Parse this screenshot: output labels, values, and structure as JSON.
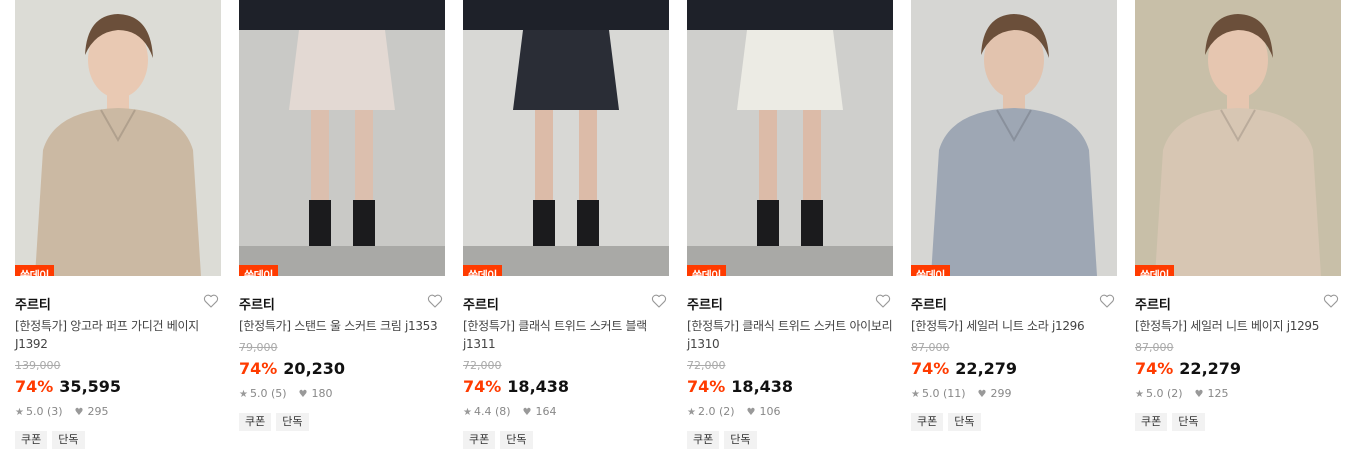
{
  "products": [
    {
      "badge": "쑥데이",
      "brand": "주르티",
      "name": "[한정특가] 앙고라 퍼프 가디건 베이지 J1392",
      "original_price": "139,000",
      "discount": "74%",
      "price": "35,595",
      "rating": "5.0 (3)",
      "likes": "295",
      "tags": [
        "쿠폰",
        "단독"
      ],
      "image": "woman-beige-cardigan",
      "colors": {
        "bg": "#dcdcd6",
        "item": "#cbb9a3",
        "skin": "#e9c9b3"
      }
    },
    {
      "badge": "쑥데이",
      "brand": "주르티",
      "name": "[한정특가] 스탠드 울 스커트 크림 j1353",
      "original_price": "79,000",
      "discount": "74%",
      "price": "20,230",
      "rating": "5.0 (5)",
      "likes": "180",
      "tags": [
        "쿠폰",
        "단독"
      ],
      "image": "cream-wool-skirt",
      "colors": {
        "bg": "#c9c9c6",
        "item": "#e3d9d3",
        "skin": "#dcbfae"
      }
    },
    {
      "badge": "쑥데이",
      "brand": "주르티",
      "name": "[한정특가] 클래식 트위드 스커트 블랙 j1311",
      "original_price": "72,000",
      "discount": "74%",
      "price": "18,438",
      "rating": "4.4 (8)",
      "likes": "164",
      "tags": [
        "쿠폰",
        "단독"
      ],
      "image": "black-tweed-skirt",
      "colors": {
        "bg": "#d8d8d5",
        "item": "#2a2d36",
        "skin": "#dcbba8"
      }
    },
    {
      "badge": "쑥데이",
      "brand": "주르티",
      "name": "[한정특가] 클래식 트위드 스커트 아이보리 j1310",
      "original_price": "72,000",
      "discount": "74%",
      "price": "18,438",
      "rating": "2.0 (2)",
      "likes": "106",
      "tags": [
        "쿠폰",
        "단독"
      ],
      "image": "ivory-tweed-skirt",
      "colors": {
        "bg": "#cfcfcc",
        "item": "#ecebe4",
        "skin": "#dcbba8"
      }
    },
    {
      "badge": "쑥데이",
      "brand": "주르티",
      "name": "[한정특가] 세일러 니트 소라 j1296",
      "original_price": "87,000",
      "discount": "74%",
      "price": "22,279",
      "rating": "5.0 (11)",
      "likes": "299",
      "tags": [
        "쿠폰",
        "단독"
      ],
      "image": "woman-blue-sailor-knit",
      "colors": {
        "bg": "#d6d6d3",
        "item": "#9ea7b4",
        "skin": "#e2c3ae"
      }
    },
    {
      "badge": "쑥데이",
      "brand": "주르티",
      "name": "[한정특가] 세일러 니트 베이지 j1295",
      "original_price": "87,000",
      "discount": "74%",
      "price": "22,279",
      "rating": "5.0 (2)",
      "likes": "125",
      "tags": [
        "쿠폰",
        "단독"
      ],
      "image": "woman-beige-sailor-knit",
      "colors": {
        "bg": "#c8bfa8",
        "item": "#d7c6b3",
        "skin": "#e6c6b0"
      }
    }
  ]
}
